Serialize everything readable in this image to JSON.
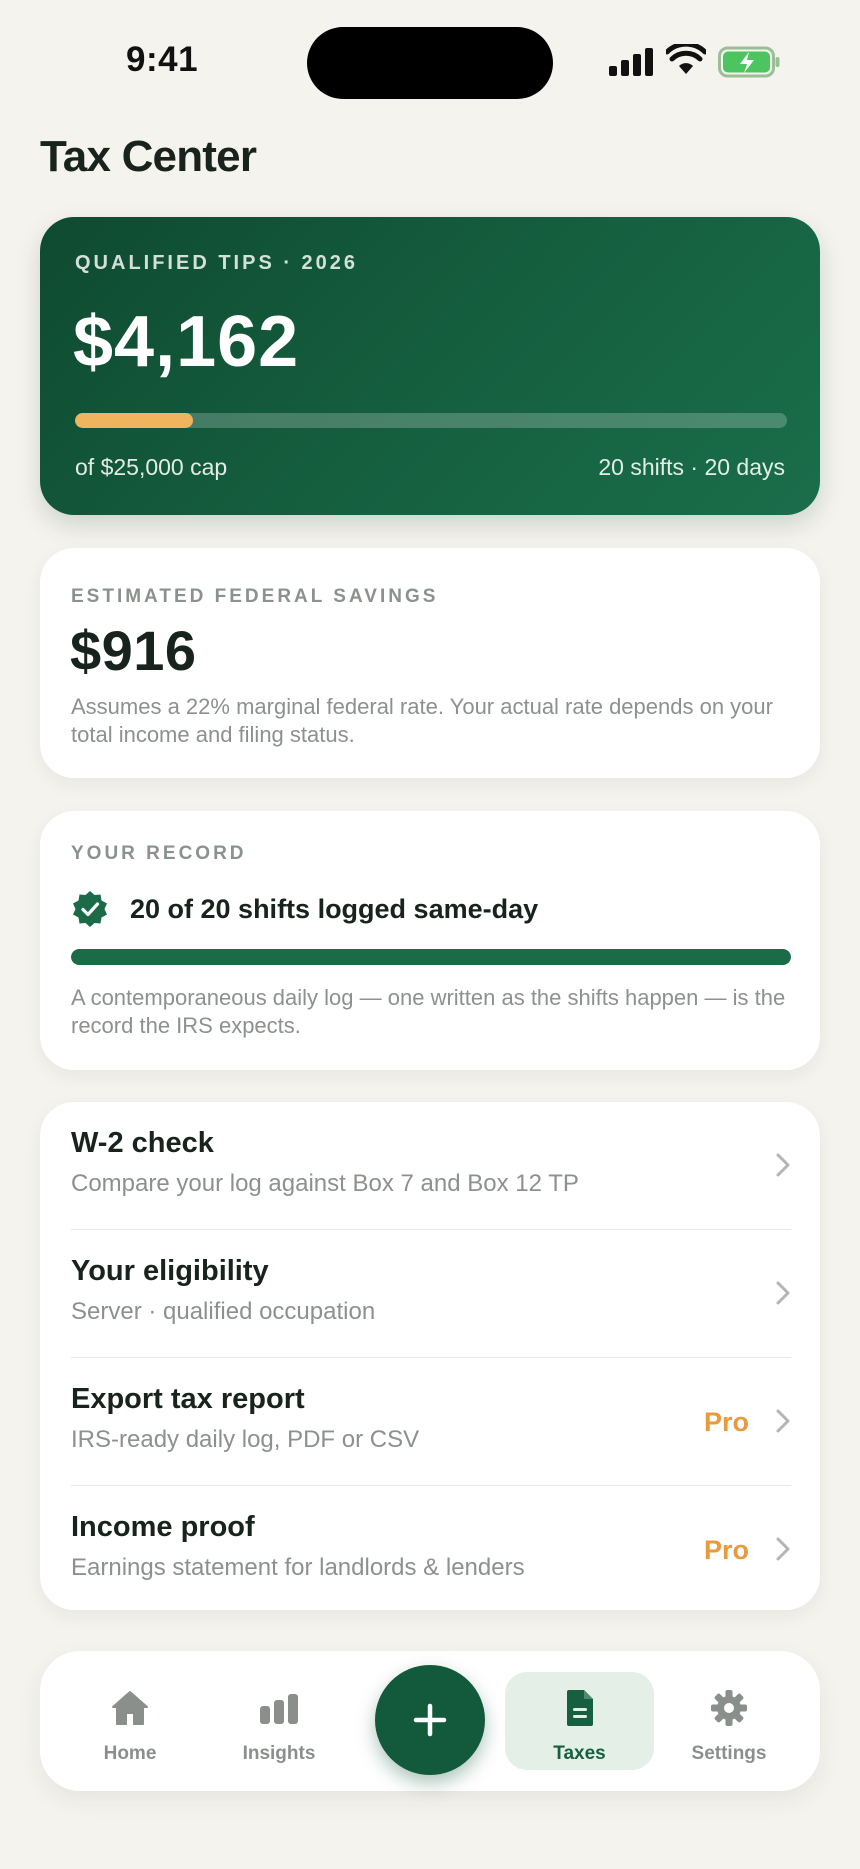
{
  "status_bar": {
    "time": "9:41"
  },
  "page": {
    "title": "Tax Center"
  },
  "hero": {
    "eyebrow": "QUALIFIED TIPS · 2026",
    "amount": "$4,162",
    "progress_fraction": 0.166,
    "cap_text": "of $25,000 cap",
    "meta_text": "20 shifts · 20 days",
    "colors": {
      "card": "#15603f",
      "progress": "#f0b45e"
    }
  },
  "savings": {
    "eyebrow": "ESTIMATED FEDERAL SAVINGS",
    "amount": "$916",
    "note": "Assumes a 22% marginal federal rate. Your actual rate depends on your total income and filing status."
  },
  "record": {
    "eyebrow": "YOUR RECORD",
    "icon": "check-badge-icon",
    "headline": "20 of 20 shifts logged same-day",
    "progress_fraction": 1.0,
    "note": "A contemporaneous daily log — one written as the shifts happen — is the record the IRS expects."
  },
  "menu": {
    "items": [
      {
        "title": "W-2 check",
        "subtitle": "Compare your log against Box 7 and Box 12 TP",
        "badge": ""
      },
      {
        "title": "Your eligibility",
        "subtitle": "Server · qualified occupation",
        "badge": ""
      },
      {
        "title": "Export tax report",
        "subtitle": "IRS-ready daily log, PDF or CSV",
        "badge": "Pro"
      },
      {
        "title": "Income proof",
        "subtitle": "Earnings statement for landlords & lenders",
        "badge": "Pro"
      }
    ]
  },
  "tab_bar": {
    "tabs": [
      {
        "label": "Home",
        "icon": "house-icon"
      },
      {
        "label": "Insights",
        "icon": "bar-chart-icon"
      },
      {
        "label": "Taxes",
        "icon": "document-icon",
        "active": true
      },
      {
        "label": "Settings",
        "icon": "gear-icon"
      }
    ],
    "fab_icon": "plus-icon",
    "accent": "#135a3c"
  }
}
